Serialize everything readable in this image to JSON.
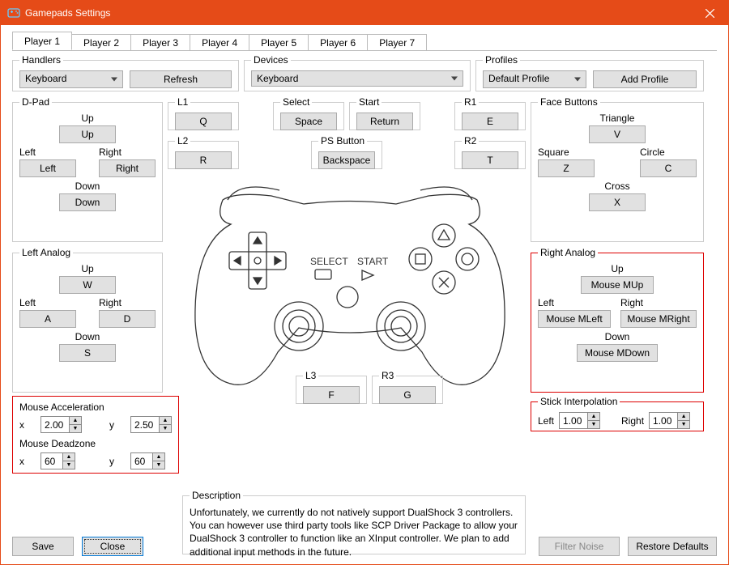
{
  "window": {
    "title": "Gamepads Settings"
  },
  "tabs": [
    "Player 1",
    "Player 2",
    "Player 3",
    "Player 4",
    "Player 5",
    "Player 6",
    "Player 7"
  ],
  "handlers": {
    "legend": "Handlers",
    "value": "Keyboard",
    "refresh": "Refresh"
  },
  "devices": {
    "legend": "Devices",
    "value": "Keyboard"
  },
  "profiles": {
    "legend": "Profiles",
    "value": "Default Profile",
    "add": "Add Profile"
  },
  "dpad": {
    "legend": "D-Pad",
    "up_l": "Up",
    "up_v": "Up",
    "left_l": "Left",
    "left_v": "Left",
    "right_l": "Right",
    "right_v": "Right",
    "down_l": "Down",
    "down_v": "Down"
  },
  "l1": {
    "legend": "L1",
    "value": "Q"
  },
  "l2": {
    "legend": "L2",
    "value": "R"
  },
  "r1": {
    "legend": "R1",
    "value": "E"
  },
  "r2": {
    "legend": "R2",
    "value": "T"
  },
  "select": {
    "legend": "Select",
    "value": "Space"
  },
  "start": {
    "legend": "Start",
    "value": "Return"
  },
  "psbtn": {
    "legend": "PS Button",
    "value": "Backspace"
  },
  "face": {
    "legend": "Face Buttons",
    "tri_l": "Triangle",
    "tri_v": "V",
    "sq_l": "Square",
    "sq_v": "Z",
    "ci_l": "Circle",
    "ci_v": "C",
    "cr_l": "Cross",
    "cr_v": "X"
  },
  "la": {
    "legend": "Left Analog",
    "up_l": "Up",
    "up_v": "W",
    "left_l": "Left",
    "left_v": "A",
    "right_l": "Right",
    "right_v": "D",
    "down_l": "Down",
    "down_v": "S"
  },
  "ra": {
    "legend": "Right Analog",
    "up_l": "Up",
    "up_v": "Mouse MUp",
    "left_l": "Left",
    "left_v": "Mouse MLeft",
    "right_l": "Right",
    "right_v": "Mouse MRight",
    "down_l": "Down",
    "down_v": "Mouse MDown"
  },
  "mouseacc": {
    "x_l": "x",
    "x_v": "2.00",
    "y_l": "y",
    "y_v": "2.50",
    "legend": "Mouse Acceleration"
  },
  "mousedz": {
    "x_l": "x",
    "x_v": "60",
    "y_l": "y",
    "y_v": "60",
    "legend": "Mouse Deadzone"
  },
  "l3": {
    "legend": "L3",
    "value": "F"
  },
  "r3": {
    "legend": "R3",
    "value": "G"
  },
  "stick": {
    "legend": "Stick Interpolation",
    "left_l": "Left",
    "left_v": "1.00",
    "right_l": "Right",
    "right_v": "1.00"
  },
  "desc": {
    "legend": "Description",
    "text": "Unfortunately, we currently do not natively support DualShock 3 controllers. You can however use third party tools like SCP Driver Package to allow your DualShock 3 controller to function like an XInput controller. We plan to add additional input methods in the future."
  },
  "footer": {
    "save": "Save",
    "close": "Close",
    "filter": "Filter Noise",
    "restore": "Restore Defaults"
  }
}
